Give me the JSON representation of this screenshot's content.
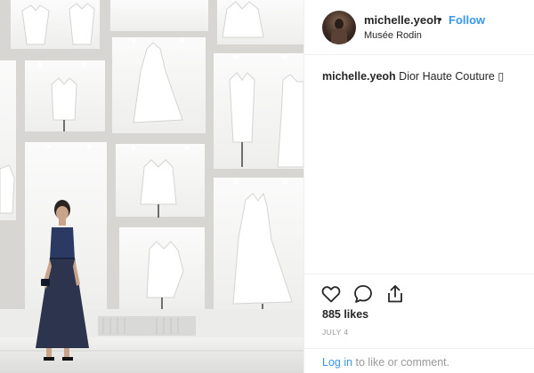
{
  "post": {
    "username": "michelle.yeoh",
    "separator": "•",
    "follow_label": "Follow",
    "location": "Musée Rodin",
    "caption_username": "michelle.yeoh",
    "caption_text": "Dior Haute Couture ▯",
    "likes": "885 likes",
    "date": "JULY 4",
    "login_link": "Log in",
    "login_rest": " to like or comment."
  },
  "icons": {
    "like": "heart-icon",
    "comment": "comment-icon",
    "share": "share-icon"
  },
  "colors": {
    "accent": "#3897f0",
    "text": "#262626",
    "muted": "#999999"
  }
}
